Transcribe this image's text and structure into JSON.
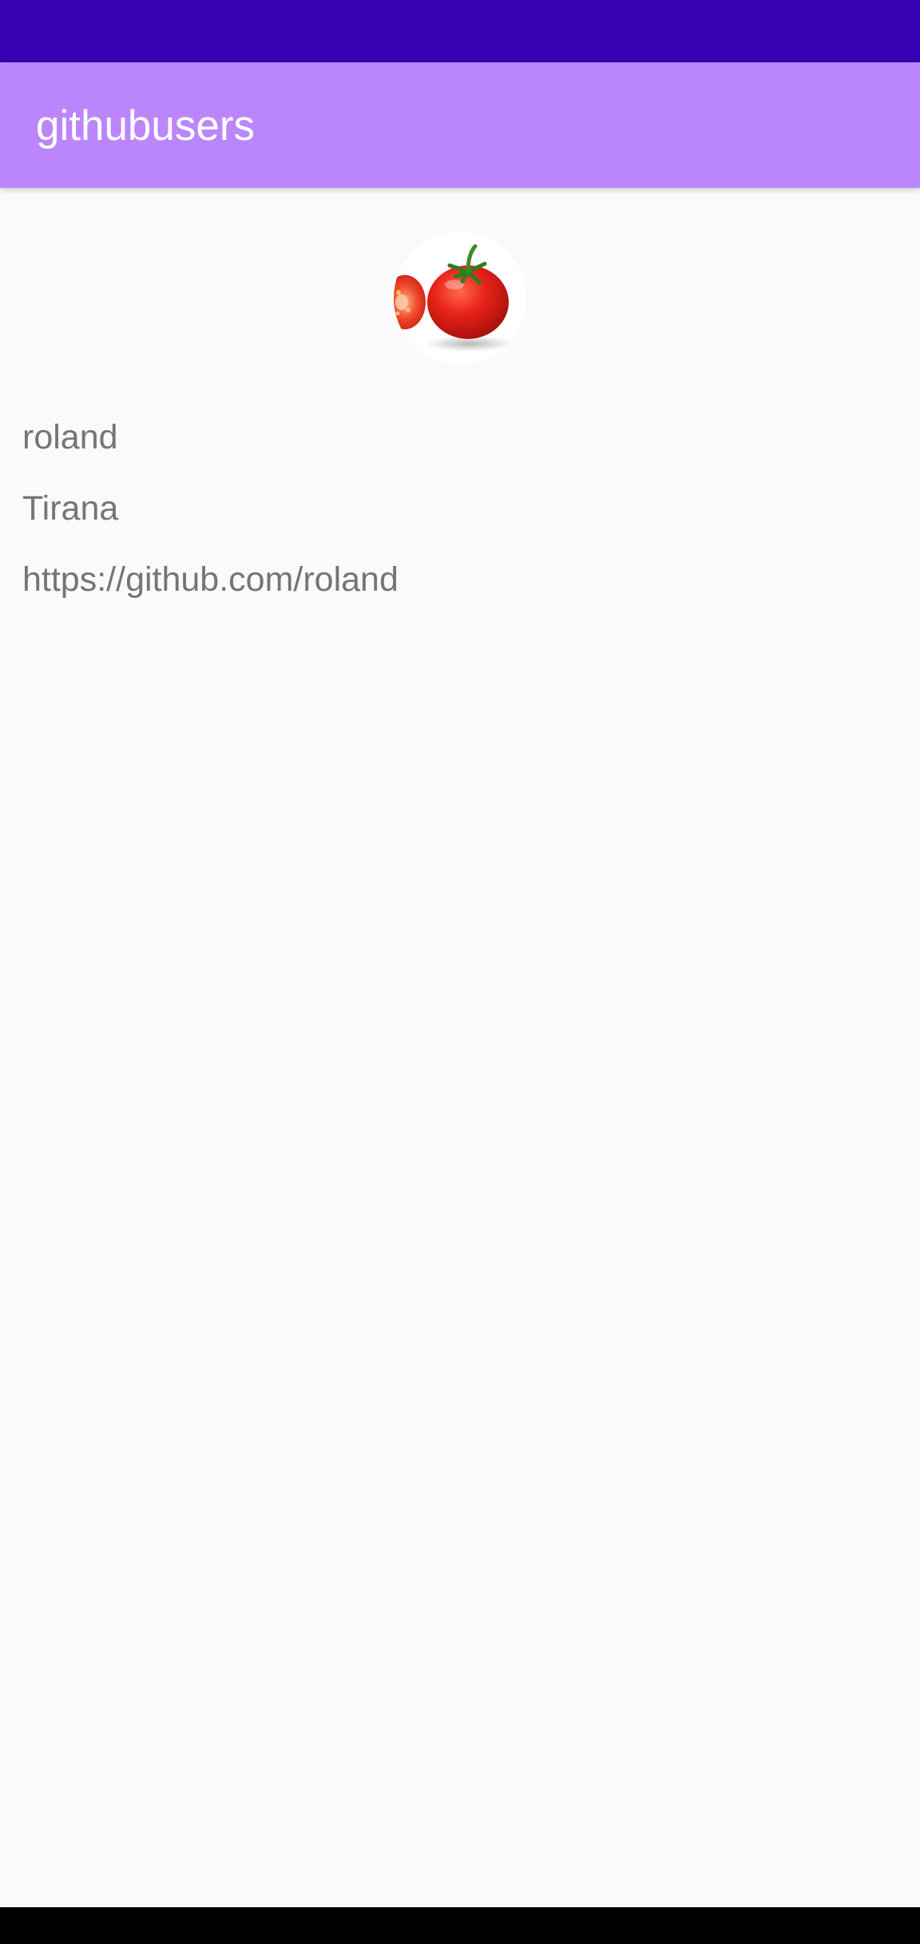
{
  "colors": {
    "status_bar": "#3700b3",
    "app_bar": "#bb86fc",
    "background": "#fafafa",
    "text_secondary": "#757575",
    "nav_bar": "#000000"
  },
  "app_bar": {
    "title": "githubusers"
  },
  "user": {
    "avatar_icon": "tomato-avatar-icon",
    "name": "roland",
    "location": "Tirana",
    "url": "https://github.com/roland"
  }
}
